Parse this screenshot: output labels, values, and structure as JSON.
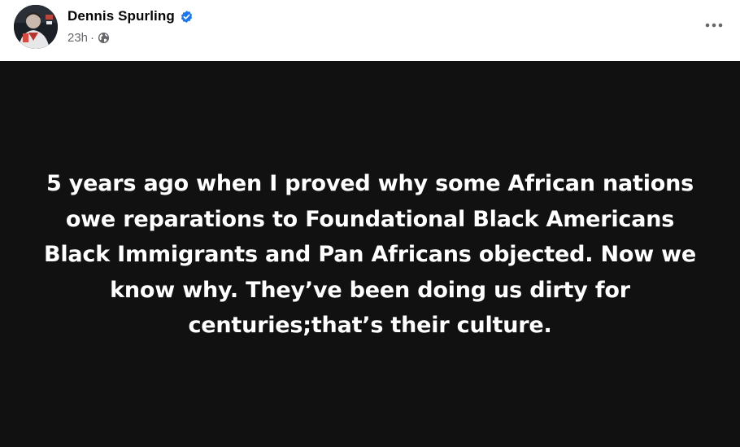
{
  "post": {
    "author": {
      "name": "Dennis Spurling",
      "verified": true
    },
    "meta": {
      "time": "23h",
      "separator": "·",
      "audience_icon": "globe-icon"
    },
    "more_icon": "more-dots-icon",
    "body": {
      "background": "#111111",
      "text_color": "#ffffff",
      "text": "5 years ago when I proved why some African nations owe reparations to Foundational Black Americans Black Immigrants and Pan Africans objected. Now we know why. They’ve been doing us dirty for centuries;that’s their culture."
    }
  },
  "colors": {
    "verified_badge": "#1877f2",
    "secondary_text": "#65676b",
    "primary_text": "#050505"
  }
}
